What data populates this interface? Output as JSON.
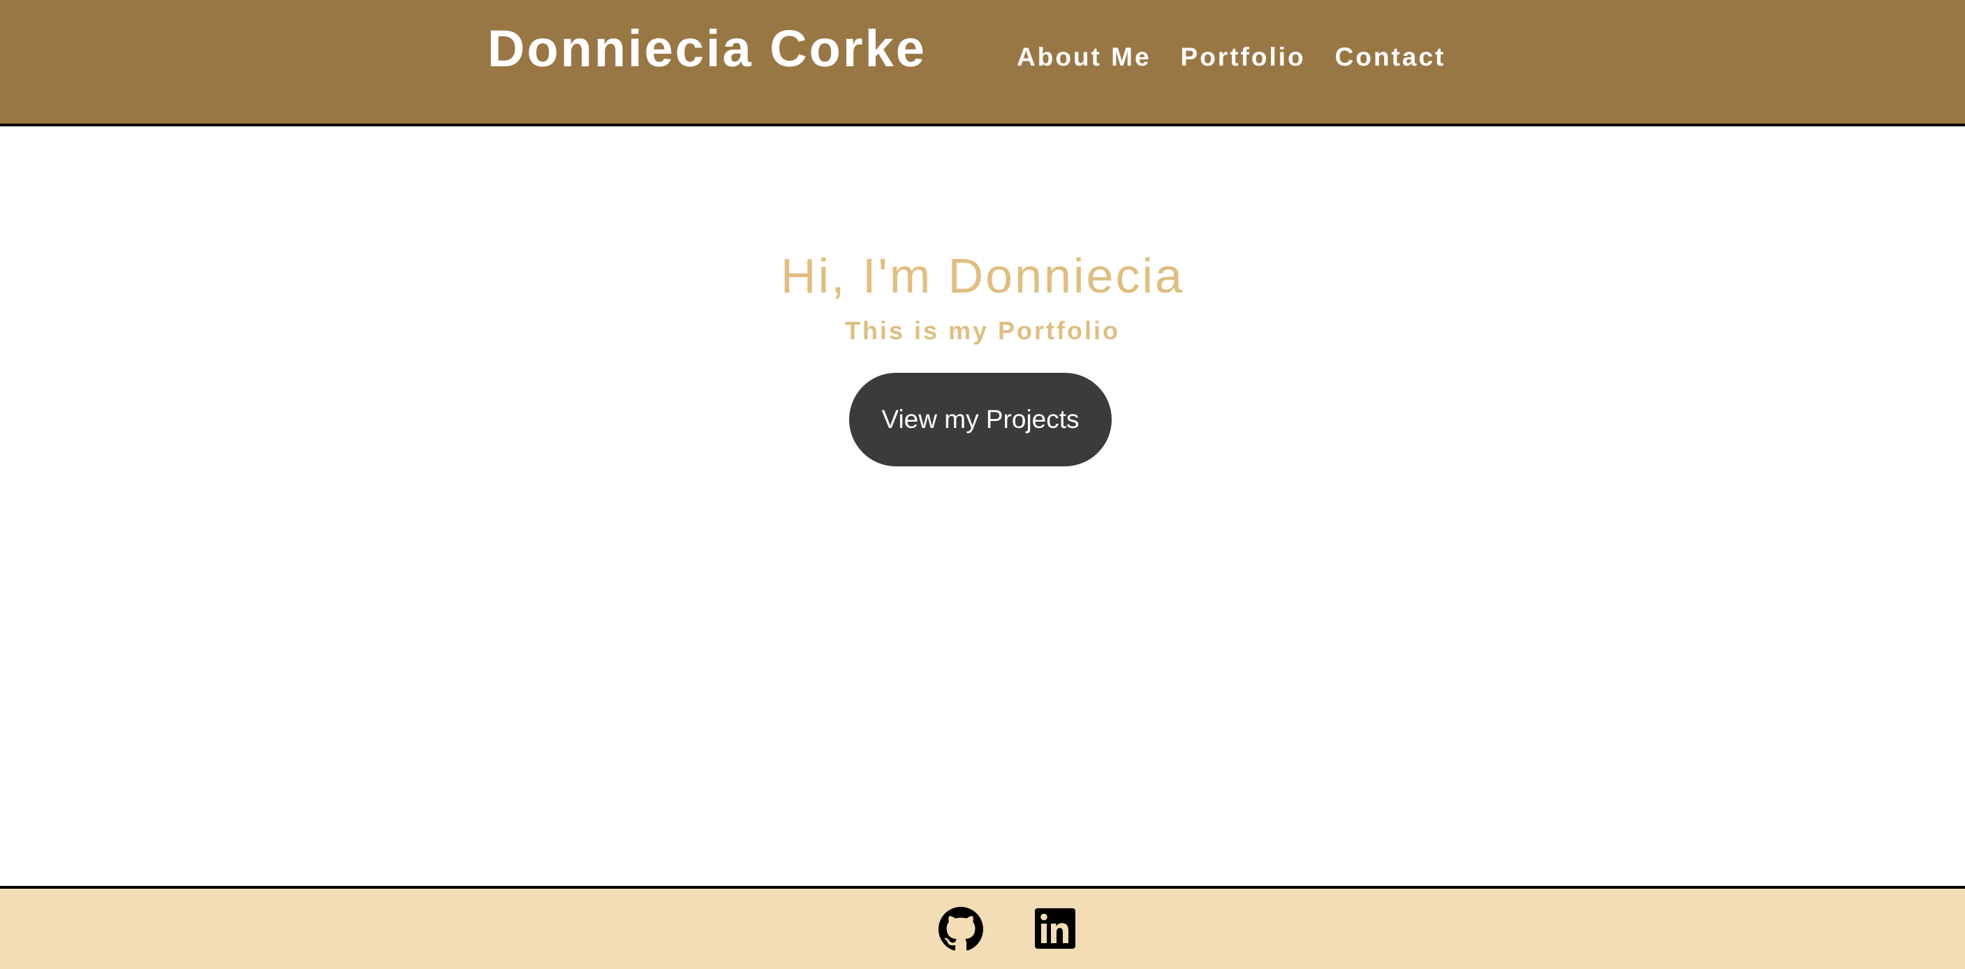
{
  "header": {
    "title": "Donniecia Corke",
    "background_color": "#997745",
    "nav": [
      {
        "label": "About Me"
      },
      {
        "label": "Portfolio"
      },
      {
        "label": "Contact"
      }
    ]
  },
  "hero": {
    "heading": "Hi, I'm Donniecia",
    "subheading": "This is my Portfolio",
    "accent_color": "#dfbe80",
    "cta_label": "View my Projects",
    "cta_color": "#3b3b3b"
  },
  "footer": {
    "background_color": "#f2ddb7",
    "links": [
      {
        "icon": "github-icon"
      },
      {
        "icon": "linkedin-icon"
      }
    ]
  }
}
